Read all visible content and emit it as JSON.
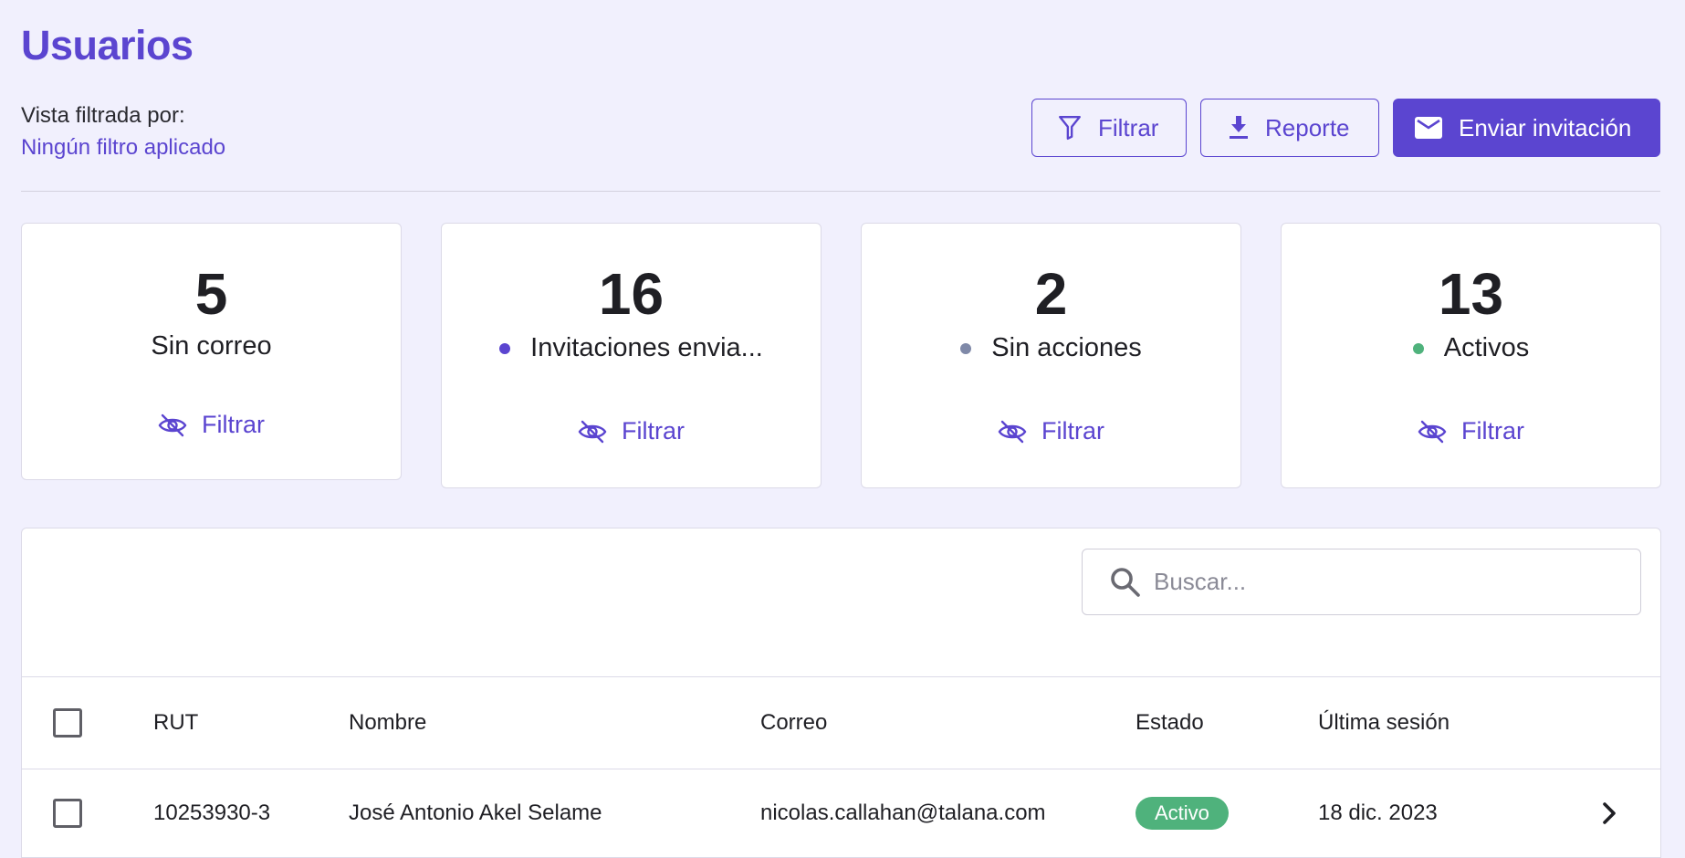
{
  "header": {
    "title": "Usuarios",
    "filter_caption": "Vista filtrada por:",
    "filter_value": "Ningún filtro aplicado"
  },
  "toolbar": {
    "filter_label": "Filtrar",
    "report_label": "Reporte",
    "invite_label": "Enviar invitación"
  },
  "stats": [
    {
      "count": "5",
      "label": "Sin correo",
      "dot_color": null,
      "action": "Filtrar"
    },
    {
      "count": "16",
      "label": "Invitaciones envia...",
      "dot_color": "#5b45d0",
      "action": "Filtrar"
    },
    {
      "count": "2",
      "label": "Sin acciones",
      "dot_color": "#7f89a8",
      "action": "Filtrar"
    },
    {
      "count": "13",
      "label": "Activos",
      "dot_color": "#4fb27c",
      "action": "Filtrar"
    }
  ],
  "search": {
    "placeholder": "Buscar...",
    "value": ""
  },
  "table": {
    "columns": [
      "RUT",
      "Nombre",
      "Correo",
      "Estado",
      "Última sesión"
    ],
    "rows": [
      {
        "rut": "10253930-3",
        "nombre": "José Antonio Akel Selame",
        "correo": "nicolas.callahan@talana.com",
        "estado": "Activo",
        "ultima_sesion": "18 dic. 2023"
      }
    ]
  },
  "colors": {
    "accent": "#5b45d0",
    "background": "#f1f0fd",
    "success": "#4fb27c",
    "neutral_dot": "#7f89a8"
  },
  "icons": {
    "filter": "funnel-icon",
    "report": "download-icon",
    "invite": "mail-icon",
    "card_filter": "eye-off-icon",
    "search": "search-icon",
    "row_open": "chevron-right-icon"
  }
}
